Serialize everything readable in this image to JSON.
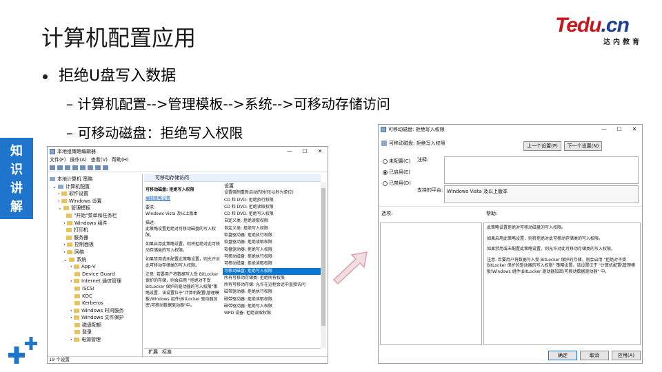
{
  "slide": {
    "title": "计算机配置应用",
    "bullet": "拒绝U盘写入数据",
    "sub1": "–  计算机配置-->管理模板-->系统-->可移动存储访问",
    "sub2": "–  可移动磁盘：拒绝写入权限",
    "side_tab": [
      "知",
      "识",
      "讲",
      "解"
    ],
    "logo": {
      "brand_main": "Tedu",
      "brand_suffix": ".cn",
      "sub": "达内教育"
    }
  },
  "gpedit": {
    "title": "本地组策略编辑器",
    "menu": [
      "文件(F)",
      "操作(A)",
      "查看(V)",
      "帮助(H)"
    ],
    "tree": [
      "本地计算机 策略",
      "计算机配置",
      "软件设置",
      "Windows 设置",
      "管理模板",
      "\"开始\"菜单和任务栏",
      "Windows 组件",
      "打印机",
      "服务器",
      "控制面板",
      "网络",
      "系统",
      "App-V",
      "Device Guard",
      "Internet 通信管理",
      "iSCSI",
      "KDC",
      "Kerberos",
      "Windows 时间服务",
      "Windows 文件保护",
      "磁盘配额",
      "登录",
      "电源管理"
    ],
    "header": "可移动存储访问",
    "desc": {
      "setting_title": "可移动磁盘: 拒绝写入权限",
      "edit_label": "编辑策略设置",
      "req_label": "要求:",
      "req_value": "Windows Vista 及以上版本",
      "desc_label": "描述:",
      "desc_text": "此策略设置拒绝对可移动磁盘的写入权限。",
      "p1": "如果启用此策略设置，则将拒绝对此可移动存储类的写入权限。",
      "p2": "如果禁用或未配置此策略设置，则允许对此可移动存储类的写入权限。",
      "note": "注意: 若要用户将数据写入受 BitLocker 保护的存储，则会启用 \"拒绝对不受 BitLocker 保护的驱动器的写入权限\"策略设置，该设置位于\"计算机配置\\管理模板\\Windows 组件\\BitLocker 驱动器加密\\可移动数据驱动器\"中。"
    },
    "list_header": "设置",
    "items": [
      "设置强制重新启动的时间(以秒为单位)",
      "CD 和 DVD: 拒绝执行权限",
      "CD 和 DVD: 拒绝读取权限",
      "CD 和 DVD: 拒绝写入权限",
      "自定义类: 拒绝读取权限",
      "自定义类: 拒绝写入权限",
      "软盘驱动器: 拒绝执行权限",
      "软盘驱动器: 拒绝读取权限",
      "软盘驱动器: 拒绝写入权限",
      "可移动磁盘: 拒绝执行权限",
      "可移动磁盘: 拒绝读取权限",
      "可移动磁盘: 拒绝写入权限",
      "所有可移动存储类: 拒绝所有权限",
      "所有可移动存储: 允许在远程会话中直接访问",
      "磁带驱动器: 拒绝执行权限",
      "磁带驱动器: 拒绝读取权限",
      "磁带驱动器: 拒绝写入权限",
      "WPD 设备: 拒绝读取权限"
    ],
    "selected_index": 11,
    "tabs": [
      "扩展",
      "标准"
    ],
    "status": "19 个设置"
  },
  "dialog": {
    "title": "可移动磁盘: 拒绝写入权限",
    "setting_name": "可移动磁盘: 拒绝写入权限",
    "prev_btn": "上一个设置(P)",
    "next_btn": "下一个设置(N)",
    "radios": [
      "未配置(C)",
      "已启用(E)",
      "已禁用(D)"
    ],
    "selected_radio": 1,
    "comment_label": "注释:",
    "platform_label": "支持的平台:",
    "platform_value": "Windows Vista 及以上版本",
    "options_label": "选项:",
    "help_label": "帮助:",
    "help": [
      "此策略设置拒绝对可移动磁盘的写入权限。",
      "如果启用此策略设置，则将拒绝对此可移动存储类的写入权限。",
      "如果禁用或未配置此策略设置，则允许对此可移动存储类的写入权限。",
      "注意: 若要用户将数据写入受 BitLocker 保护的存储，则会启用 \"拒绝对不受 BitLocker 保护的驱动器的写入权限\" 策略设置，该设置位于 \"计算机配置\\管理模板\\Windows 组件\\BitLocker 驱动器加密\\可移动数据驱动器\" 中。"
    ],
    "ok": "确定",
    "cancel": "取消",
    "apply": "应用(A)"
  },
  "colors": {
    "accent": "#1f75cc",
    "brand_red": "#c8161d",
    "brand_blue": "#1c3f94",
    "selection": "#0a76d6",
    "arrow": "#d9a0a8"
  }
}
